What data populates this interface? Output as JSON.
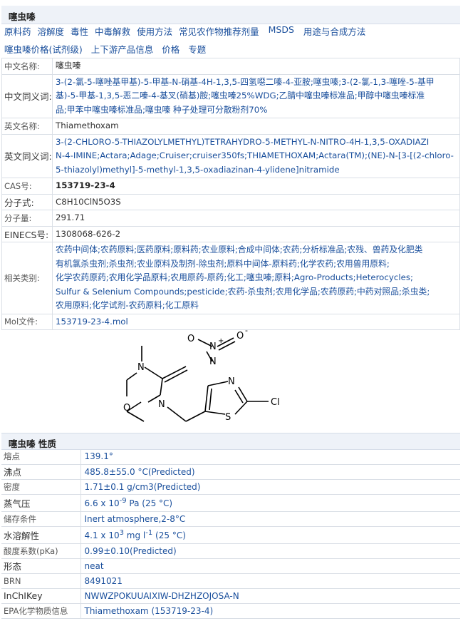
{
  "header": {
    "title": "噻虫嗪"
  },
  "nav": {
    "row1": [
      "原料药",
      "溶解度",
      "毒性",
      "中毒解救",
      "使用方法",
      "常见农作物推荐剂量",
      "MSDS",
      "用途与合成方法"
    ],
    "row2": [
      "噻虫嗪价格(试剂级)",
      "上下游产品信息",
      "价格",
      "专题"
    ]
  },
  "info": {
    "cn_name": {
      "label": "中文名称:",
      "value": "噻虫嗪"
    },
    "cn_syn": {
      "label": "中文同义词:",
      "line1": "3-(2-氯-5-噻唑基甲基)-5-甲基-N-硝基-4H-1,3,5-四氢噁二嗪-4-亚胺;噻虫嗪;3-(2-氯-1,3-噻唑-5-基甲",
      "line2": "基)-5-甲基-1,3,5-恶二嗪-4-基叉(硝基)胺;噻虫嗪25%WDG;乙腈中噻虫嗪标准品;甲醇中噻虫嗪标准",
      "line3": "品;甲苯中噻虫嗪标准品;噻虫嗪 种子处理可分散粉剂70%"
    },
    "en_name": {
      "label": "英文名称:",
      "value": "Thiamethoxam"
    },
    "en_syn": {
      "label": "英文同义词:",
      "line1": "3-(2-CHLORO-5-THIAZOLYLMETHYL)TETRAHYDRO-5-METHYL-N-NITRO-4H-1,3,5-OXADIAZI",
      "line2": "N-4-IMINE;Actara;Adage;Cruiser;cruiser350fs;THIAMETHOXAM;Actara(TM);(NE)-N-[3-[(2-chloro-",
      "line3": "5-thiazolyl)methyl]-5-methyl-1,3,5-oxadiazinan-4-ylidene]nitramide"
    },
    "cas": {
      "label": "CAS号:",
      "value": "153719-23-4"
    },
    "formula": {
      "label": "分子式:",
      "value": "C8H10ClN5O3S"
    },
    "mw": {
      "label": "分子量:",
      "value": "291.71"
    },
    "einecs": {
      "label": "EINECS号:",
      "value": "1308068-626-2"
    },
    "category": {
      "label": "相关类别:",
      "line1": "农药中间体;农药原料;医药原料;原料药;农业原料;合成中间体;农药;分析标准品;农残、兽药及化肥类",
      "line2": "有机氯杀虫剂;杀虫剂;农业原料及制剂-除虫剂;原料中间体-原料药;化学农药;农用兽用原料;",
      "line3": "化学农药原药;农用化学品原料;农用原药-原药;化工;噻虫嗪;原料;Agro-Products;Heterocycles;",
      "line4": "Sulfur & Selenium Compounds;pesticide;农药-杀虫剂;农用化学品;农药原药;中药对照品;杀虫类;",
      "line5": "农用原料;化学试剂-农药原料;化工原料"
    },
    "mol": {
      "label": "Mol文件:",
      "value": "153719-23-4.mol"
    }
  },
  "structure": {
    "atoms": [
      "N",
      "O",
      "N",
      "N",
      "N",
      "O",
      "O",
      "N",
      "S",
      "Cl"
    ],
    "plus": "+",
    "minus": "-"
  },
  "properties": {
    "title": "噻虫嗪 性质",
    "rows": [
      {
        "label": "熔点",
        "value": "139.1°"
      },
      {
        "label": "沸点",
        "value": "485.8±55.0 °C(Predicted)"
      },
      {
        "label": "密度",
        "value": "1.71±0.1 g/cm3(Predicted)"
      },
      {
        "label": "蒸气压",
        "value_pre": "6.6 x 10",
        "value_sup": "-9",
        "value_post": " Pa (25 °C)"
      },
      {
        "label": "储存条件",
        "value": "Inert atmosphere,2-8°C"
      },
      {
        "label": "水溶解性",
        "value_pre": "4.1 x 10",
        "value_sup": "3",
        "value_mid": " mg l",
        "value_sup2": "-1",
        "value_post": " (25 °C)"
      },
      {
        "label": "酸度系数(pKa)",
        "value": "0.99±0.10(Predicted)"
      },
      {
        "label": "形态",
        "value": "neat"
      },
      {
        "label": "BRN",
        "value": "8491021"
      },
      {
        "label": "InChIKey",
        "value": "NWWZPOKUUAIXIW-DHZHZOJOSA-N"
      },
      {
        "label": "EPA化学物质信息",
        "value": "Thiamethoxam (153719-23-4)"
      }
    ]
  },
  "colors": {
    "link": "#1a4f9c",
    "header_bg": "#eef2f8",
    "border": "#dadfe6"
  }
}
